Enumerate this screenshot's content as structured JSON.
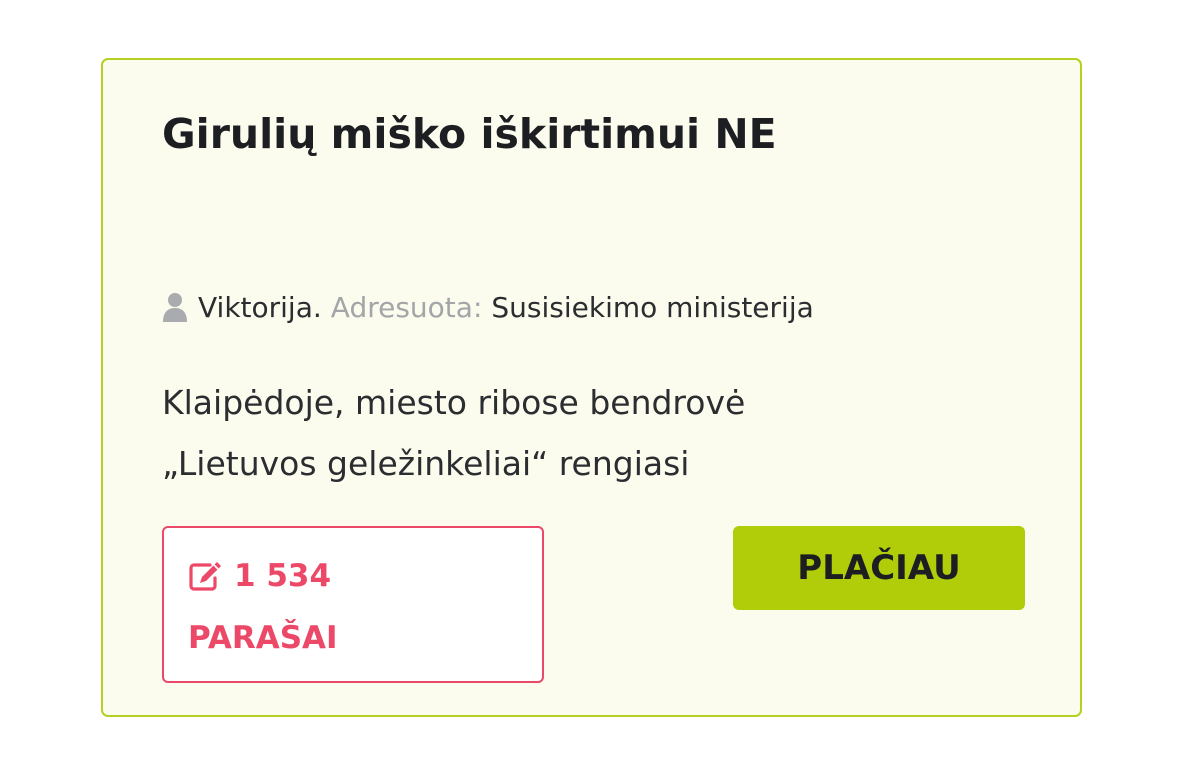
{
  "petition": {
    "title": "Girulių miško iškirtimui NE",
    "author": "Viktorija.",
    "addressed_label": "Adresuota:",
    "addressed_to": "Susisiekimo ministerija",
    "excerpt_lines": [
      "Klaipėdoje, miesto ribose bendrovė",
      "„Lietuvos geležinkeliai“ rengiasi"
    ],
    "signatures": {
      "count": "1 534",
      "label": "PARAŠAI"
    },
    "more_button": "PLAČIAU"
  },
  "colors": {
    "card_background": "#fbfcee",
    "card_border": "#b5d020",
    "signature_accent": "#ec4867",
    "button_background": "#b1cd0a",
    "muted_text": "#a3a5a8"
  },
  "icons": {
    "author": "user-icon",
    "signatures": "edit-icon"
  }
}
